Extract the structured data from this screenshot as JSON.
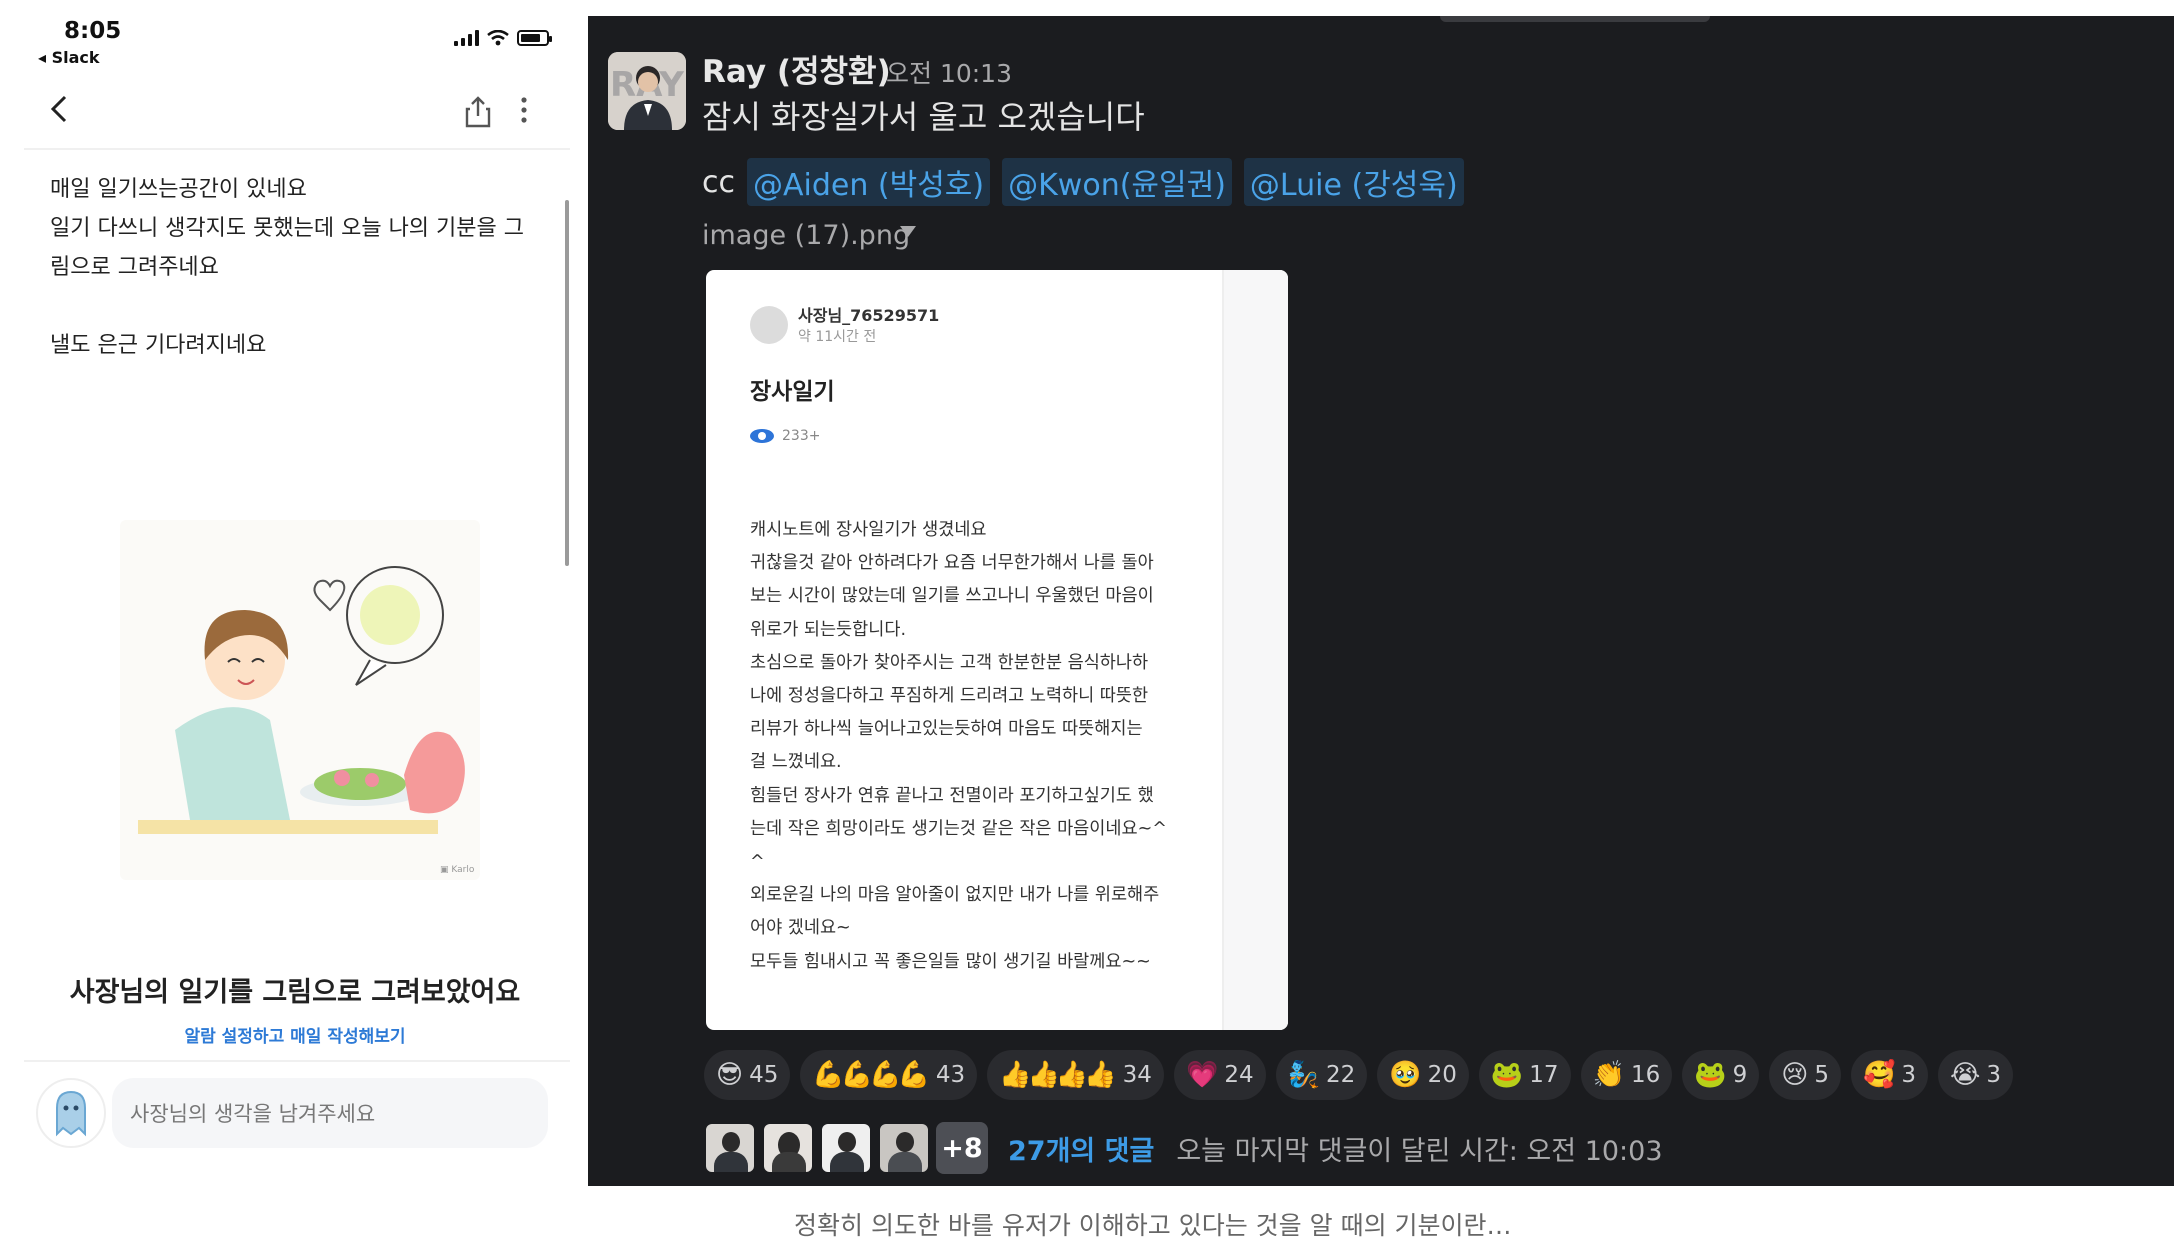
{
  "phone": {
    "status": {
      "time": "8:05",
      "back_app": "◂ Slack"
    },
    "diary": {
      "lines": [
        "매일 일기쓰는공간이 있네요",
        "일기 다쓰니  생각지도 못했는데  오늘  나의 기분을  그",
        "림으로  그려주네요",
        "",
        "낼도 은근  기다려지네요"
      ]
    },
    "caption_title": "사장님의 일기를 그림으로 그려보았어요",
    "caption_link": "알람 설정하고 매일 작성해보기",
    "comment_placeholder": "사장님의 생각을 남겨주세요"
  },
  "slack": {
    "message": {
      "author": "Ray (정창환)",
      "time": "오전 10:13",
      "text": "잠시 화장실가서 울고 오겠습니다",
      "cc_label": "cc",
      "mentions": [
        "@Aiden (박성호)",
        "@Kwon(윤일권)",
        "@Luie (강성욱)"
      ],
      "file_name": "image (17).png"
    },
    "image_card": {
      "user": "사장님_76529571",
      "ago": "약 11시간 전",
      "title": "장사일기",
      "views": "233+",
      "body_lines": [
        "캐시노트에 장사일기가 생겼네요",
        "귀찮을것 같아 안하려다가 요즘 너무한가해서 나를 돌아",
        "보는 시간이 많았는데 일기를 쓰고나니 우울했던 마음이",
        "위로가 되는듯합니다.",
        "초심으로 돌아가 찾아주시는 고객 한분한분 음식하나하",
        "나에 정성을다하고 푸짐하게 드리려고 노력하니 따뜻한",
        "리뷰가 하나씩 늘어나고있는듯하여 마음도 따뜻해지는",
        "걸 느꼈네요.",
        "힘들던 장사가 연휴 끝나고 전멸이라 포기하고싶기도 했",
        "는데 작은 희망이라도 생기는것 같은 작은 마음이네요~^",
        "^",
        "외로운길 나의 마음 알아줄이 없지만 내가 나를 위로해주",
        "어야 겠네요~",
        "모두들 힘내시고 꼭 좋은일들 많이 생기길 바랄께요~~"
      ]
    },
    "reactions": [
      {
        "emoji": "😎",
        "count": "45",
        "icon": "sunglasses-emoji"
      },
      {
        "emoji": "💪💪💪💪",
        "count": "43",
        "icon": "flexed-biceps-emoji"
      },
      {
        "emoji": "👍👍👍👍",
        "count": "34",
        "icon": "thumbs-up-emoji"
      },
      {
        "emoji": "💗",
        "count": "24",
        "icon": "heart-emoji"
      },
      {
        "emoji": "🧞",
        "count": "22",
        "icon": "genie-emoji"
      },
      {
        "emoji": "🥹",
        "count": "20",
        "icon": "teary-face-emoji"
      },
      {
        "emoji": "🐸",
        "count": "17",
        "icon": "frog-emoji"
      },
      {
        "emoji": "👏",
        "count": "16",
        "icon": "clap-emoji"
      },
      {
        "emoji": "🐸",
        "count": "9",
        "icon": "pepe-emoji"
      },
      {
        "emoji": "😢",
        "count": "5",
        "icon": "crying-face-emoji"
      },
      {
        "emoji": "🥰",
        "count": "3",
        "icon": "smiling-hearts-emoji"
      },
      {
        "emoji": "😭",
        "count": "3",
        "icon": "loudly-crying-emoji"
      }
    ],
    "thread": {
      "more": "+8",
      "replies": "27개의 댓글",
      "last_reply": "오늘 마지막 댓글이 달린 시간: 오전 10:03"
    }
  },
  "bottom_caption": "정확히 의도한 바를 유저가 이해하고 있다는 것을 알 때의 기분이란…",
  "colors": {
    "slack_bg": "#1b1c1f",
    "mention_text": "#4aa3e8",
    "link_blue": "#2d7ad6"
  }
}
